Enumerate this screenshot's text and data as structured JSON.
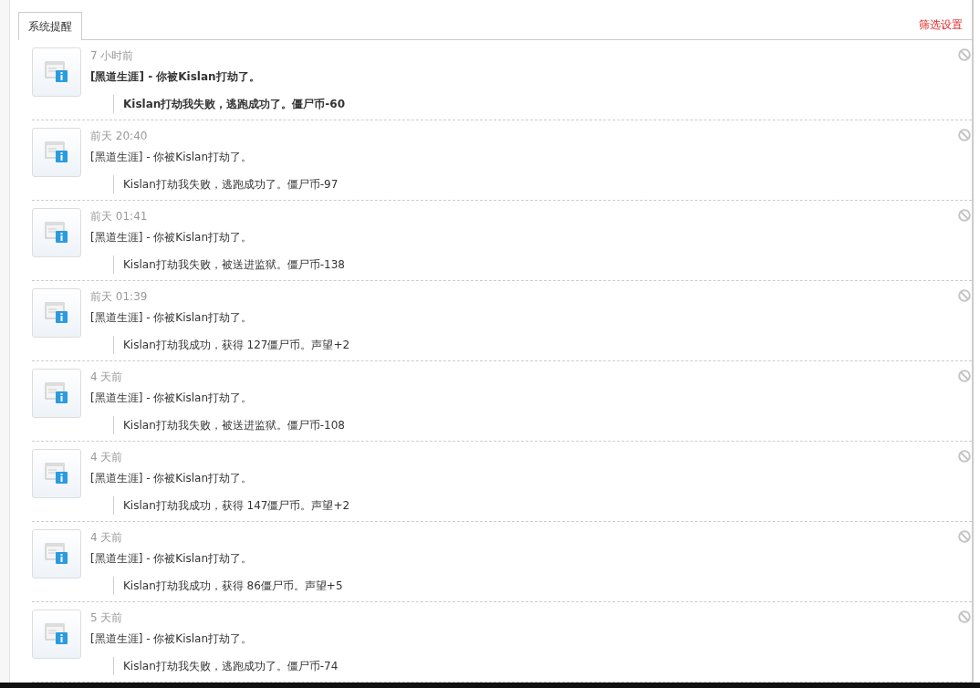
{
  "tabs": [
    {
      "label": "系统提醒",
      "selected": true
    }
  ],
  "filter_link": "筛选设置",
  "notices": [
    {
      "time": "7 小时前",
      "title": "[黑道生涯] - 你被Kislan打劫了。",
      "detail": "Kislan打劫我失败，逃跑成功了。僵尸币-60",
      "unread": true
    },
    {
      "time": "前天 20:40",
      "title": "[黑道生涯] - 你被Kislan打劫了。",
      "detail": "Kislan打劫我失败，逃跑成功了。僵尸币-97",
      "unread": false
    },
    {
      "time": "前天 01:41",
      "title": "[黑道生涯] - 你被Kislan打劫了。",
      "detail": "Kislan打劫我失败，被送进监狱。僵尸币-138",
      "unread": false
    },
    {
      "time": "前天 01:39",
      "title": "[黑道生涯] - 你被Kislan打劫了。",
      "detail": "Kislan打劫我成功，获得 127僵尸币。声望+2",
      "unread": false
    },
    {
      "time": "4 天前",
      "title": "[黑道生涯] - 你被Kislan打劫了。",
      "detail": "Kislan打劫我失败，被送进监狱。僵尸币-108",
      "unread": false
    },
    {
      "time": "4 天前",
      "title": "[黑道生涯] - 你被Kislan打劫了。",
      "detail": "Kislan打劫我成功，获得 147僵尸币。声望+2",
      "unread": false
    },
    {
      "time": "4 天前",
      "title": "[黑道生涯] - 你被Kislan打劫了。",
      "detail": "Kislan打劫我成功，获得 86僵尸币。声望+5",
      "unread": false
    },
    {
      "time": "5 天前",
      "title": "[黑道生涯] - 你被Kislan打劫了。",
      "detail": "Kislan打劫我失败，逃跑成功了。僵尸币-74",
      "unread": false
    }
  ]
}
